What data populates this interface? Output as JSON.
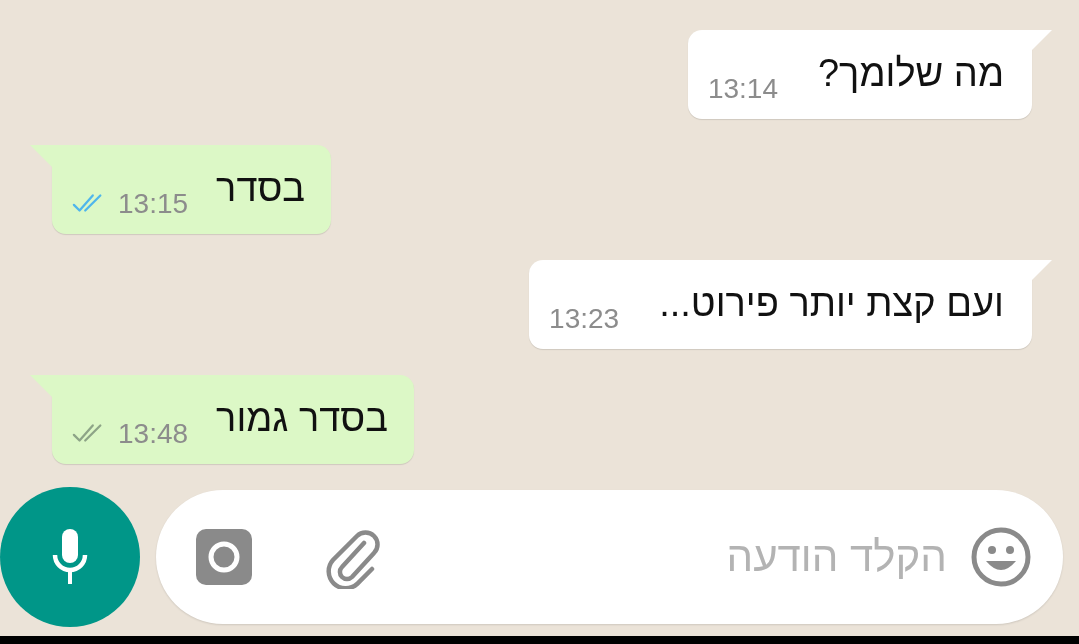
{
  "messages": [
    {
      "kind": "incoming",
      "text": "מה שלומך?",
      "time": "13:14"
    },
    {
      "kind": "outgoing",
      "text": "בסדר",
      "time": "13:15",
      "read": true
    },
    {
      "kind": "incoming",
      "text": "ועם קצת יותר פירוט...",
      "time": "13:23"
    },
    {
      "kind": "outgoing",
      "text": "בסדר גמור",
      "time": "13:48",
      "read": false
    }
  ],
  "composer": {
    "placeholder": "הקלד הודעה"
  }
}
